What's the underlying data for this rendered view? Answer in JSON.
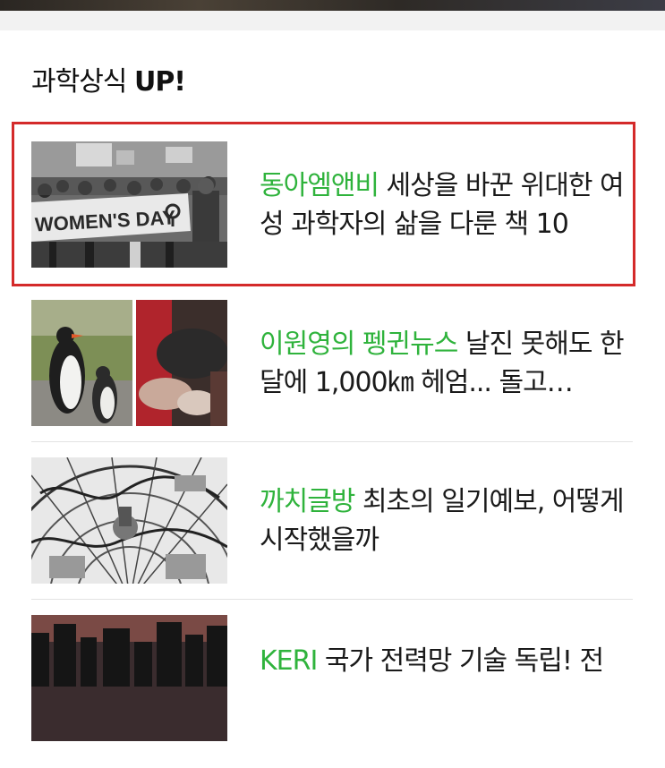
{
  "section": {
    "title_prefix": "과학상식",
    "title_suffix": "UP!"
  },
  "articles": [
    {
      "category": "동아엠앤비",
      "headline": "세상을 바꾼 위대한 여성 과학자의 삶을 다룬 책 10",
      "banner_text": "WOMEN'S DAY",
      "highlighted": true
    },
    {
      "category": "이원영의 펭귄뉴스",
      "headline": "날진 못해도 한 달에 1,000㎞ 헤엄... 돌고…",
      "highlighted": false
    },
    {
      "category": "까치글방",
      "headline": "최초의 일기예보, 어떻게 시작했을까",
      "highlighted": false
    },
    {
      "category": "KERI",
      "headline": "국가 전력망 기술 독립! 전",
      "highlighted": false
    }
  ],
  "colors": {
    "category_green": "#2fb33c",
    "highlight_border": "#d42a2a"
  }
}
